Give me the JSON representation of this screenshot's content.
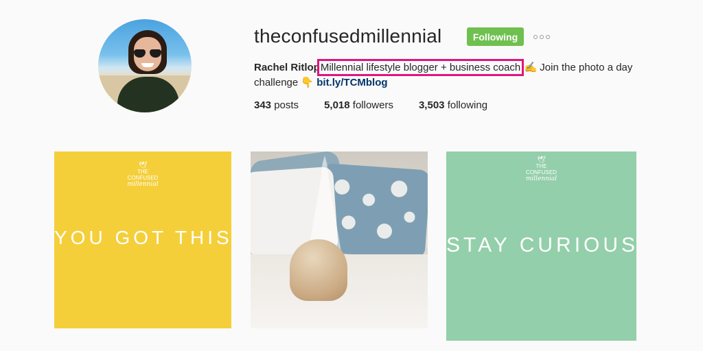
{
  "profile": {
    "username": "theconfusedmillennial",
    "follow_button_label": "Following",
    "more_options_icon": "ellipsis-icon",
    "full_name": "Rachel Ritlop",
    "bio_highlighted": "Millennial lifestyle blogger + business coach",
    "bio_after": " ✍ Join the photo a day challenge 👇 ",
    "bio_link": "bit.ly/TCMblog",
    "highlight_color": "#e0157b",
    "following_button_color": "#70c050"
  },
  "stats": {
    "posts_count": "343",
    "posts_label": "posts",
    "followers_count": "5,018",
    "followers_label": "followers",
    "following_count": "3,503",
    "following_label": "following"
  },
  "posts": [
    {
      "brand_line1": "THE",
      "brand_line2": "CONFUSED",
      "brand_line3": "millennial",
      "quote": "YOU GOT THIS.",
      "background": "#f4cf3a"
    },
    {
      "description_icon": "diffuser-photo"
    },
    {
      "brand_line1": "THE",
      "brand_line2": "CONFUSED",
      "brand_line3": "millennial",
      "quote": "STAY CURIOUS.",
      "background": "#93cfaa"
    }
  ]
}
